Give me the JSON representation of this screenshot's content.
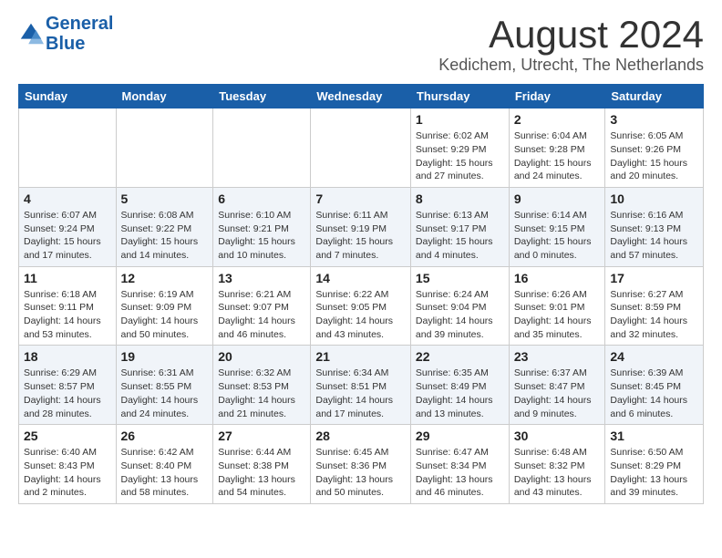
{
  "header": {
    "logo_line1": "General",
    "logo_line2": "Blue",
    "title": "August 2024",
    "subtitle": "Kedichem, Utrecht, The Netherlands"
  },
  "days_of_week": [
    "Sunday",
    "Monday",
    "Tuesday",
    "Wednesday",
    "Thursday",
    "Friday",
    "Saturday"
  ],
  "weeks": [
    [
      {
        "day": "",
        "info": ""
      },
      {
        "day": "",
        "info": ""
      },
      {
        "day": "",
        "info": ""
      },
      {
        "day": "",
        "info": ""
      },
      {
        "day": "1",
        "info": "Sunrise: 6:02 AM\nSunset: 9:29 PM\nDaylight: 15 hours\nand 27 minutes."
      },
      {
        "day": "2",
        "info": "Sunrise: 6:04 AM\nSunset: 9:28 PM\nDaylight: 15 hours\nand 24 minutes."
      },
      {
        "day": "3",
        "info": "Sunrise: 6:05 AM\nSunset: 9:26 PM\nDaylight: 15 hours\nand 20 minutes."
      }
    ],
    [
      {
        "day": "4",
        "info": "Sunrise: 6:07 AM\nSunset: 9:24 PM\nDaylight: 15 hours\nand 17 minutes."
      },
      {
        "day": "5",
        "info": "Sunrise: 6:08 AM\nSunset: 9:22 PM\nDaylight: 15 hours\nand 14 minutes."
      },
      {
        "day": "6",
        "info": "Sunrise: 6:10 AM\nSunset: 9:21 PM\nDaylight: 15 hours\nand 10 minutes."
      },
      {
        "day": "7",
        "info": "Sunrise: 6:11 AM\nSunset: 9:19 PM\nDaylight: 15 hours\nand 7 minutes."
      },
      {
        "day": "8",
        "info": "Sunrise: 6:13 AM\nSunset: 9:17 PM\nDaylight: 15 hours\nand 4 minutes."
      },
      {
        "day": "9",
        "info": "Sunrise: 6:14 AM\nSunset: 9:15 PM\nDaylight: 15 hours\nand 0 minutes."
      },
      {
        "day": "10",
        "info": "Sunrise: 6:16 AM\nSunset: 9:13 PM\nDaylight: 14 hours\nand 57 minutes."
      }
    ],
    [
      {
        "day": "11",
        "info": "Sunrise: 6:18 AM\nSunset: 9:11 PM\nDaylight: 14 hours\nand 53 minutes."
      },
      {
        "day": "12",
        "info": "Sunrise: 6:19 AM\nSunset: 9:09 PM\nDaylight: 14 hours\nand 50 minutes."
      },
      {
        "day": "13",
        "info": "Sunrise: 6:21 AM\nSunset: 9:07 PM\nDaylight: 14 hours\nand 46 minutes."
      },
      {
        "day": "14",
        "info": "Sunrise: 6:22 AM\nSunset: 9:05 PM\nDaylight: 14 hours\nand 43 minutes."
      },
      {
        "day": "15",
        "info": "Sunrise: 6:24 AM\nSunset: 9:04 PM\nDaylight: 14 hours\nand 39 minutes."
      },
      {
        "day": "16",
        "info": "Sunrise: 6:26 AM\nSunset: 9:01 PM\nDaylight: 14 hours\nand 35 minutes."
      },
      {
        "day": "17",
        "info": "Sunrise: 6:27 AM\nSunset: 8:59 PM\nDaylight: 14 hours\nand 32 minutes."
      }
    ],
    [
      {
        "day": "18",
        "info": "Sunrise: 6:29 AM\nSunset: 8:57 PM\nDaylight: 14 hours\nand 28 minutes."
      },
      {
        "day": "19",
        "info": "Sunrise: 6:31 AM\nSunset: 8:55 PM\nDaylight: 14 hours\nand 24 minutes."
      },
      {
        "day": "20",
        "info": "Sunrise: 6:32 AM\nSunset: 8:53 PM\nDaylight: 14 hours\nand 21 minutes."
      },
      {
        "day": "21",
        "info": "Sunrise: 6:34 AM\nSunset: 8:51 PM\nDaylight: 14 hours\nand 17 minutes."
      },
      {
        "day": "22",
        "info": "Sunrise: 6:35 AM\nSunset: 8:49 PM\nDaylight: 14 hours\nand 13 minutes."
      },
      {
        "day": "23",
        "info": "Sunrise: 6:37 AM\nSunset: 8:47 PM\nDaylight: 14 hours\nand 9 minutes."
      },
      {
        "day": "24",
        "info": "Sunrise: 6:39 AM\nSunset: 8:45 PM\nDaylight: 14 hours\nand 6 minutes."
      }
    ],
    [
      {
        "day": "25",
        "info": "Sunrise: 6:40 AM\nSunset: 8:43 PM\nDaylight: 14 hours\nand 2 minutes."
      },
      {
        "day": "26",
        "info": "Sunrise: 6:42 AM\nSunset: 8:40 PM\nDaylight: 13 hours\nand 58 minutes."
      },
      {
        "day": "27",
        "info": "Sunrise: 6:44 AM\nSunset: 8:38 PM\nDaylight: 13 hours\nand 54 minutes."
      },
      {
        "day": "28",
        "info": "Sunrise: 6:45 AM\nSunset: 8:36 PM\nDaylight: 13 hours\nand 50 minutes."
      },
      {
        "day": "29",
        "info": "Sunrise: 6:47 AM\nSunset: 8:34 PM\nDaylight: 13 hours\nand 46 minutes."
      },
      {
        "day": "30",
        "info": "Sunrise: 6:48 AM\nSunset: 8:32 PM\nDaylight: 13 hours\nand 43 minutes."
      },
      {
        "day": "31",
        "info": "Sunrise: 6:50 AM\nSunset: 8:29 PM\nDaylight: 13 hours\nand 39 minutes."
      }
    ]
  ]
}
